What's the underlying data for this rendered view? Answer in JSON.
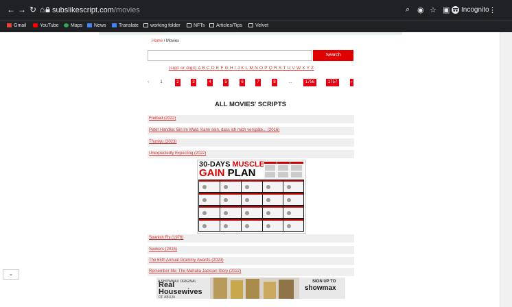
{
  "browser": {
    "url_host": "subslikescript.com",
    "url_path": "/movies",
    "incognito_label": "Incognito",
    "bookmarks": [
      "Gmail",
      "YouTube",
      "Maps",
      "News",
      "Translate",
      "working folder",
      "NFTs",
      "Articles/Tips",
      "Velvet"
    ]
  },
  "breadcrumb": {
    "home": "Home",
    "separator": "/",
    "current": "Movies"
  },
  "search": {
    "button": "Search",
    "value": ""
  },
  "alphabet": {
    "first": "(sign or digit)",
    "letters": [
      "A",
      "B",
      "C",
      "D",
      "E",
      "F",
      "G",
      "H",
      "I",
      "J",
      "K",
      "L",
      "M",
      "N",
      "O",
      "P",
      "Q",
      "R",
      "S",
      "T",
      "U",
      "V",
      "W",
      "X",
      "Y",
      "Z"
    ]
  },
  "pagination": {
    "prev": "‹",
    "current": "1",
    "pages": [
      "2",
      "3",
      "4",
      "5",
      "6",
      "7",
      "8"
    ],
    "ellipsis": "...",
    "last_pages": [
      "1756",
      "1757"
    ],
    "next": "›"
  },
  "heading": "ALL MOVIES' SCRIPTS",
  "movies_top": [
    "Freibad (2022)",
    "Peter Handke: Bin im Wald. Kann sein, dass ich mich verspäte... (2016)",
    "Thuniyu (2023)",
    "Unexpectedly Expecting (2022)"
  ],
  "movies_bottom": [
    "Spanish Fly (1976)",
    "Seekers (2016)",
    "The 65th Annual Grammy Awards (2023)",
    "Remember Me: The Mahalia Jackson Story (2022)"
  ],
  "ad": {
    "title_line1_a": "30-DAYS",
    "title_line1_b": "MUSCLE",
    "title_line2_a": "GAIN",
    "title_line2_b": "PLAN"
  },
  "bottom_ad": {
    "network": "A SHOWMAX ORIGINAL",
    "title": "Real Housewives",
    "subtitle": "OF ABUJA",
    "signup": "SIGN UP TO",
    "logo": "showmax"
  },
  "colors": {
    "accent": "#e00000",
    "link": "#d32f2f"
  }
}
